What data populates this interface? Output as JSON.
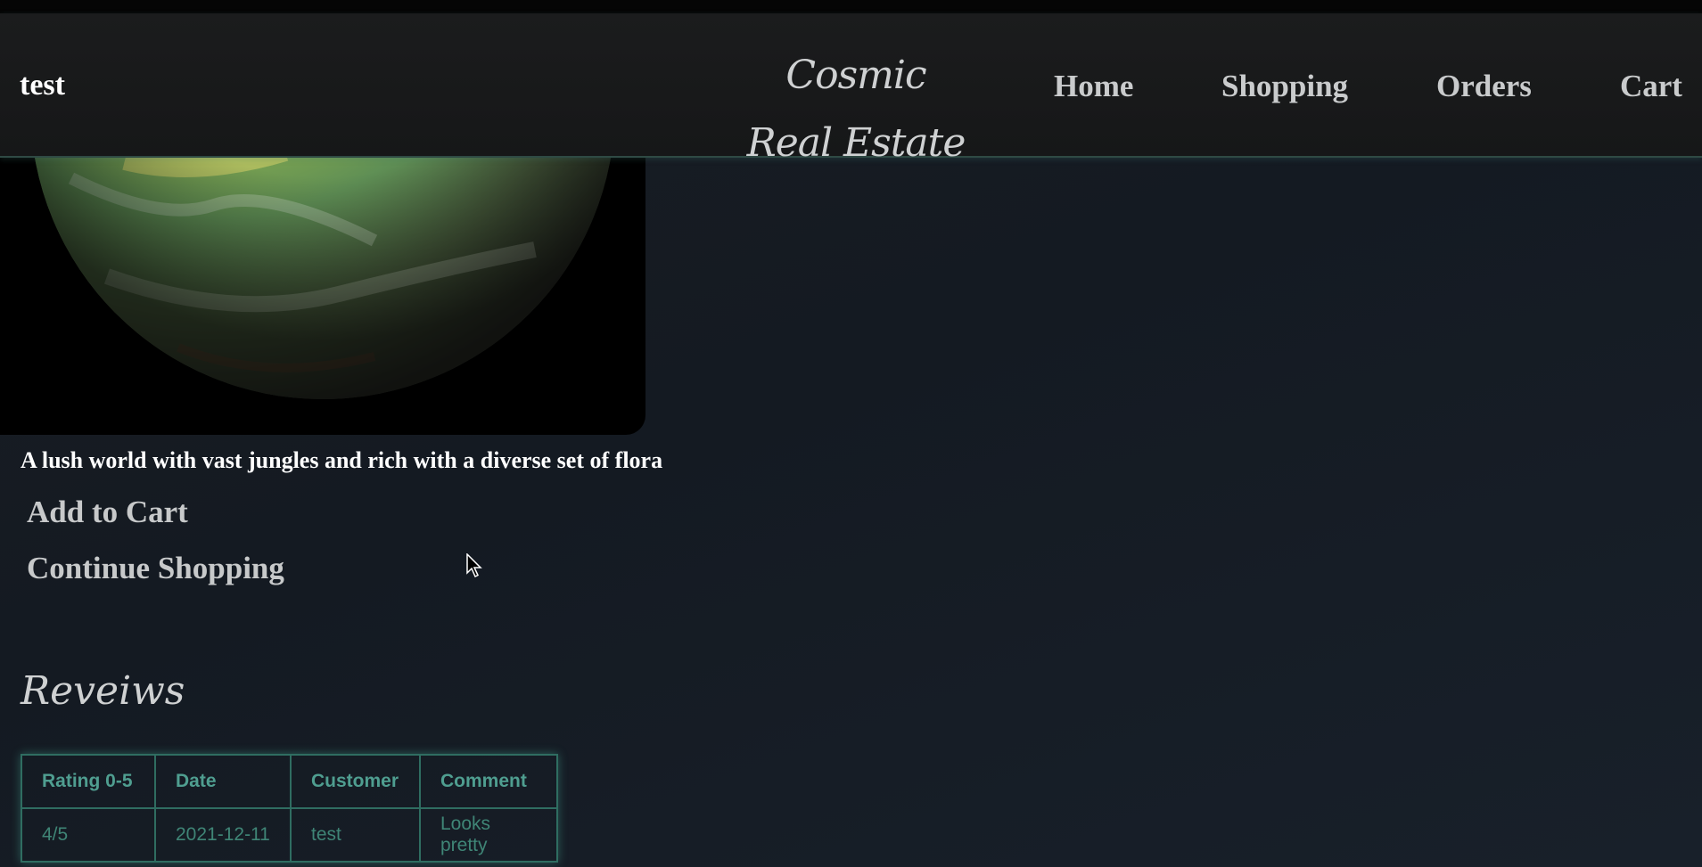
{
  "header": {
    "user": "test",
    "brand": "Cosmic Real Estate",
    "nav": [
      "Home",
      "Shopping",
      "Orders",
      "Cart"
    ]
  },
  "product": {
    "image": "green-planet-image",
    "description": "A lush world with vast jungles and rich with a diverse set of flora",
    "add_to_cart": "Add to Cart",
    "continue_shopping": "Continue Shopping"
  },
  "reviews": {
    "title": "Reveiws",
    "columns": [
      "Rating 0-5",
      "Date",
      "Customer",
      "Comment"
    ],
    "rows": [
      [
        "4/5",
        "2021-12-11",
        "test",
        "Looks pretty"
      ]
    ]
  },
  "colors": {
    "accent": "#3f8e7e",
    "nav_text": "#c9cbcc"
  }
}
